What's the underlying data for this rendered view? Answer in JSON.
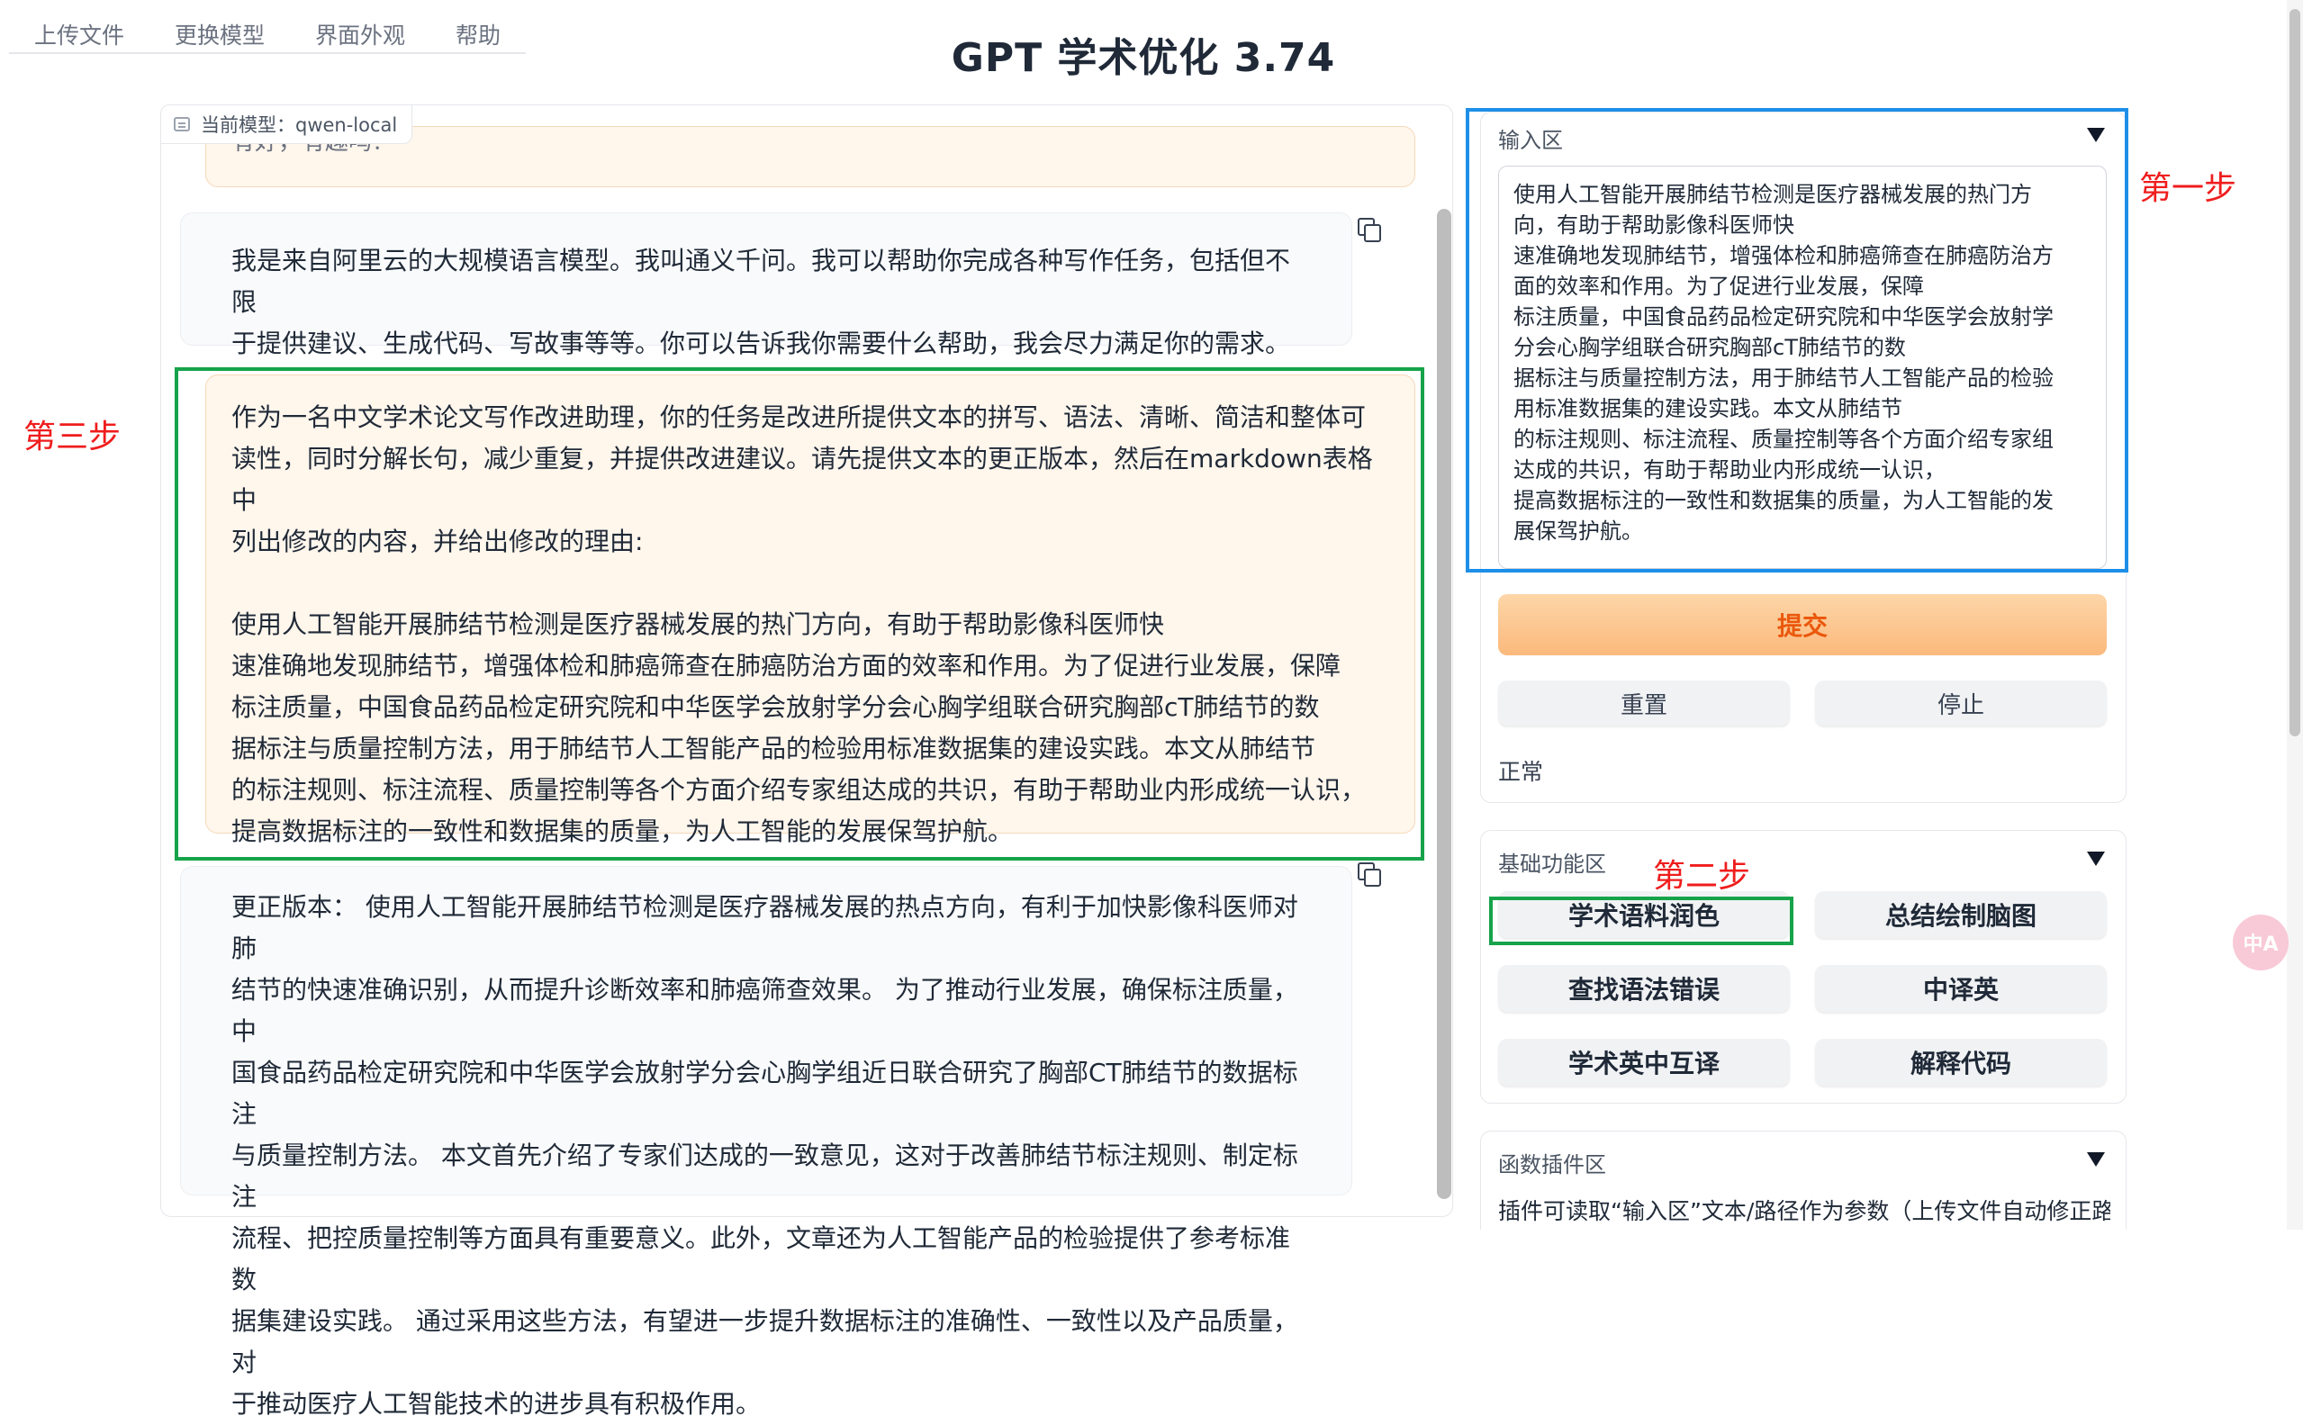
{
  "menu": {
    "tabs": [
      "上传文件",
      "更换模型",
      "界面外观",
      "帮助"
    ]
  },
  "app": {
    "title": "GPT 学术优化 3.74"
  },
  "chat": {
    "model_badge": "当前模型：qwen-local",
    "partial_top": "有好，有趣吗？",
    "bot_intro": [
      "我是来自阿里云的大规模语言模型。我叫通义千问。我可以帮助你完成各种写作任务，包括但不限",
      "于提供建议、生成代码、写故事等等。你可以告诉我你需要什么帮助，我会尽力满足你的需求。"
    ],
    "user_prompt": [
      "作为一名中文学术论文写作改进助理，你的任务是改进所提供文本的拼写、语法、清晰、简洁和整体可",
      "读性，同时分解长句，减少重复，并提供改进建议。请先提供文本的更正版本，然后在markdown表格中",
      "列出修改的内容，并给出修改的理由:"
    ],
    "user_text": [
      "使用人工智能开展肺结节检测是医疗器械发展的热门方向，有助于帮助影像科医师快",
      "速准确地发现肺结节，增强体检和肺癌筛查在肺癌防治方面的效率和作用。为了促进行业发展，保障",
      "标注质量，中国食品药品检定研究院和中华医学会放射学分会心胸学组联合研究胸部cT肺结节的数",
      "据标注与质量控制方法，用于肺结节人工智能产品的检验用标准数据集的建设实践。本文从肺结节",
      "的标注规则、标注流程、质量控制等各个方面介绍专家组达成的共识，有助于帮助业内形成统一认识，",
      "提高数据标注的一致性和数据集的质量，为人工智能的发展保驾护航。"
    ],
    "bot_reply": [
      "更正版本： 使用人工智能开展肺结节检测是医疗器械发展的热点方向，有利于加快影像科医师对肺",
      "结节的快速准确识别，从而提升诊断效率和肺癌筛查效果。 为了推动行业发展，确保标注质量，中",
      "国食品药品检定研究院和中华医学会放射学分会心胸学组近日联合研究了胸部CT肺结节的数据标注",
      "与质量控制方法。 本文首先介绍了专家们达成的一致意见，这对于改善肺结节标注规则、制定标注",
      "流程、把控质量控制等方面具有重要意义。此外，文章还为人工智能产品的检验提供了参考标准数",
      "据集建设实践。 通过采用这些方法，有望进一步提升数据标注的准确性、一致性以及产品质量，对",
      "于推动医疗人工智能技术的进步具有积极作用。"
    ]
  },
  "input_area": {
    "label": "输入区",
    "text": "使用人工智能开展肺结节检测是医疗器械发展的热门方\n向，有助于帮助影像科医师快\n速准确地发现肺结节，增强体检和肺癌筛查在肺癌防治方\n面的效率和作用。为了促进行业发展，保障\n标注质量，中国食品药品检定研究院和中华医学会放射学\n分会心胸学组联合研究胸部cT肺结节的数\n据标注与质量控制方法，用于肺结节人工智能产品的检验\n用标准数据集的建设实践。本文从肺结节\n的标注规则、标注流程、质量控制等各个方面介绍专家组\n达成的共识，有助于帮助业内形成统一认识，\n提高数据标注的一致性和数据集的质量，为人工智能的发\n展保驾护航。",
    "submit": "提交",
    "reset": "重置",
    "stop": "停止",
    "status": "正常"
  },
  "basic_functions": {
    "label": "基础功能区",
    "buttons": [
      "学术语料润色",
      "总结绘制脑图",
      "查找语法错误",
      "中译英",
      "学术英中互译",
      "解释代码"
    ]
  },
  "plugins": {
    "label": "函数插件区",
    "desc": "插件可读取“输入区”文本/路径作为参数（上传文件自动修正路"
  },
  "annotations": {
    "step1": "第一步",
    "step2": "第二步",
    "step3": "第三步",
    "color_blue": "#1d8fe8",
    "color_green": "#16a34a",
    "color_red": "#ef1d1d"
  },
  "fab": {
    "label": "中A"
  }
}
